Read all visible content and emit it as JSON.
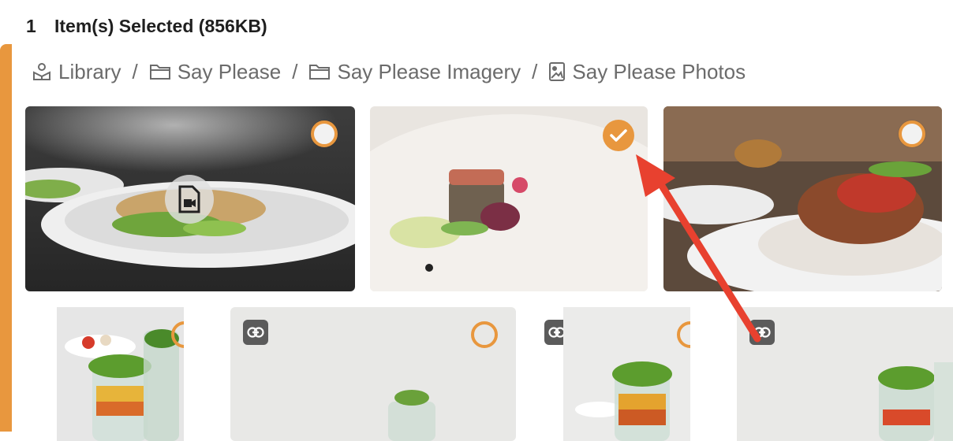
{
  "selection": {
    "count": "1",
    "label": "Item(s) Selected (856KB)"
  },
  "breadcrumb": [
    {
      "label": "Library",
      "icon": "library-icon"
    },
    {
      "label": "Say Please",
      "icon": "folder-icon"
    },
    {
      "label": "Say Please Imagery",
      "icon": "folder-icon"
    },
    {
      "label": "Say Please Photos",
      "icon": "image-folder-icon"
    }
  ],
  "separator": "/",
  "gallery": {
    "accent_color": "#e8973e",
    "items": [
      {
        "type": "video",
        "selected": false
      },
      {
        "type": "image",
        "selected": true
      },
      {
        "type": "image",
        "selected": false
      },
      {
        "type": "image",
        "selected": false
      },
      {
        "type": "linked-image",
        "selected": false
      },
      {
        "type": "linked-image",
        "selected": false
      },
      {
        "type": "linked-image",
        "selected": false
      }
    ]
  },
  "annotation": {
    "icon": "red-arrow",
    "color": "#e8412f"
  }
}
